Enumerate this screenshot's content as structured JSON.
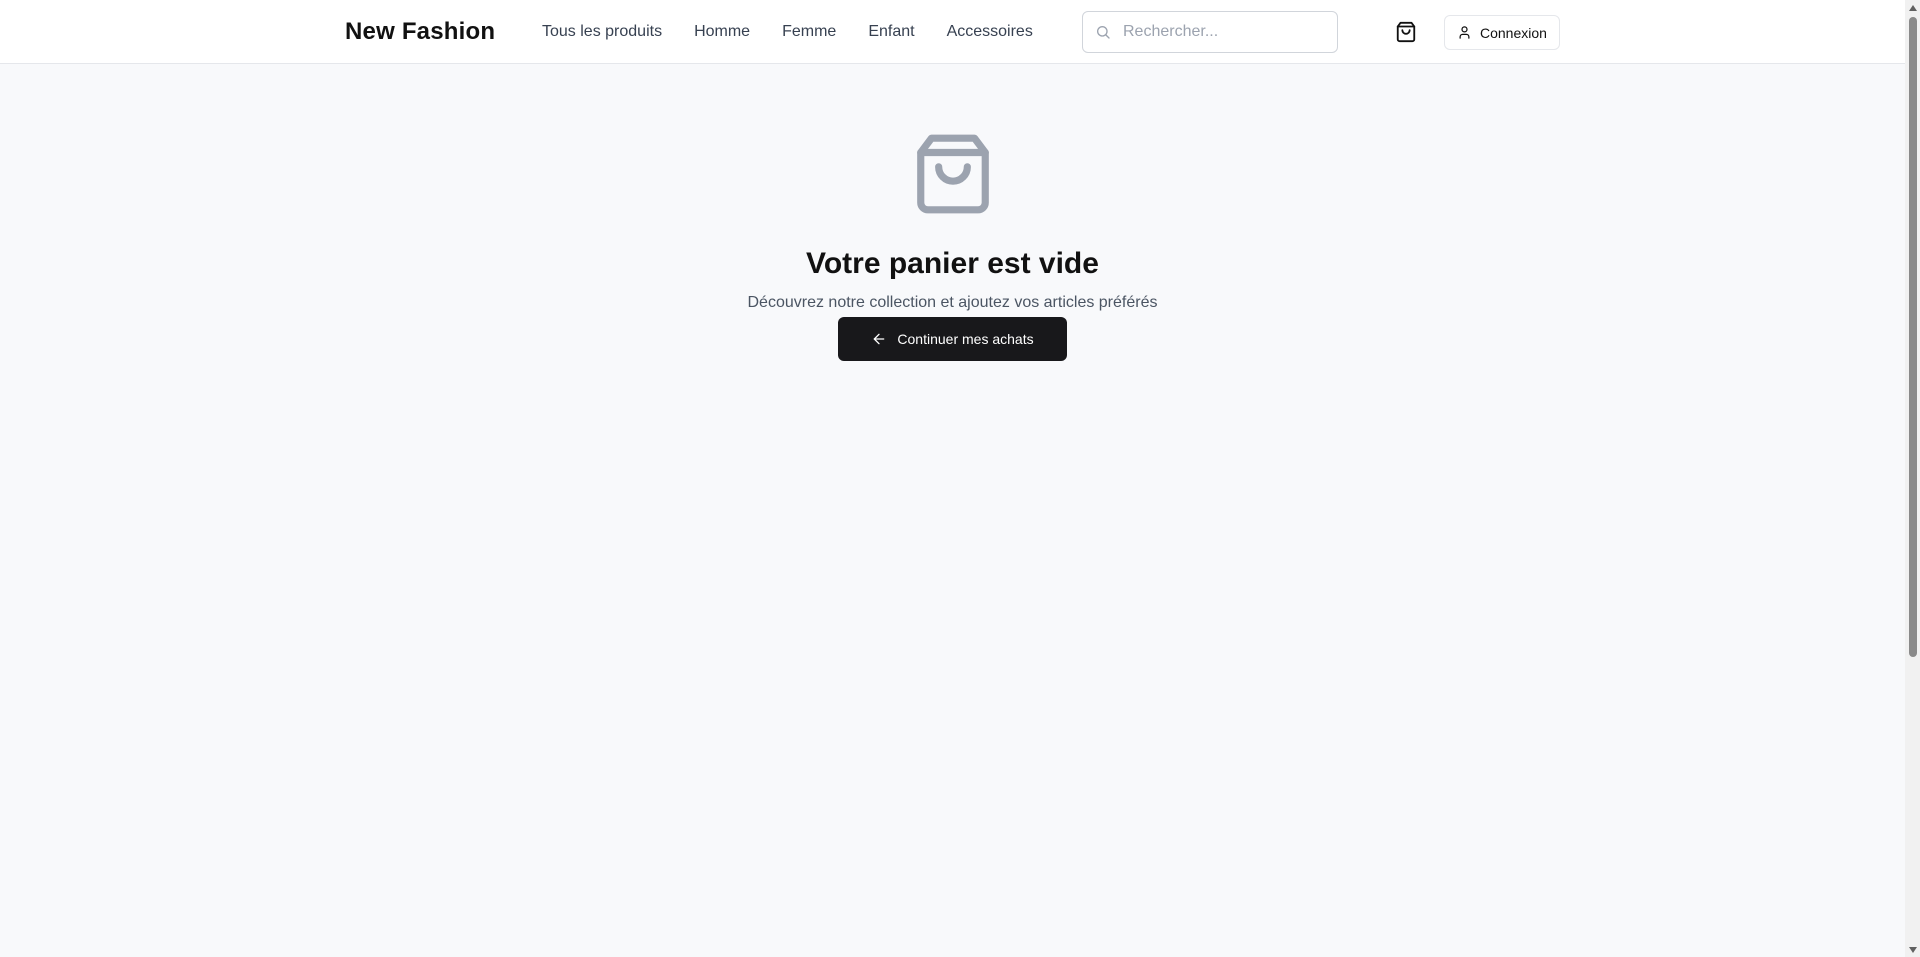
{
  "header": {
    "logo": "New Fashion",
    "nav": [
      {
        "label": "Tous les produits",
        "name": "nav-tous-les-produits"
      },
      {
        "label": "Homme",
        "name": "nav-homme"
      },
      {
        "label": "Femme",
        "name": "nav-femme"
      },
      {
        "label": "Enfant",
        "name": "nav-enfant"
      },
      {
        "label": "Accessoires",
        "name": "nav-accessoires"
      }
    ],
    "search": {
      "placeholder": "Rechercher...",
      "value": "",
      "icon": "search-icon"
    },
    "cart": {
      "icon": "shopping-bag-icon"
    },
    "login": {
      "label": "Connexion",
      "icon": "user-icon"
    }
  },
  "empty_cart": {
    "icon": "shopping-bag-icon",
    "title": "Votre panier est vide",
    "subtitle": "Découvrez notre collection et ajoutez vos articles préférés",
    "button": {
      "label": "Continuer mes achats",
      "icon": "arrow-left-icon"
    }
  },
  "colors": {
    "background": "#f8f9fb",
    "header_bg": "#ffffff",
    "button_dark": "#18181b",
    "icon_muted": "#9ca3af"
  }
}
